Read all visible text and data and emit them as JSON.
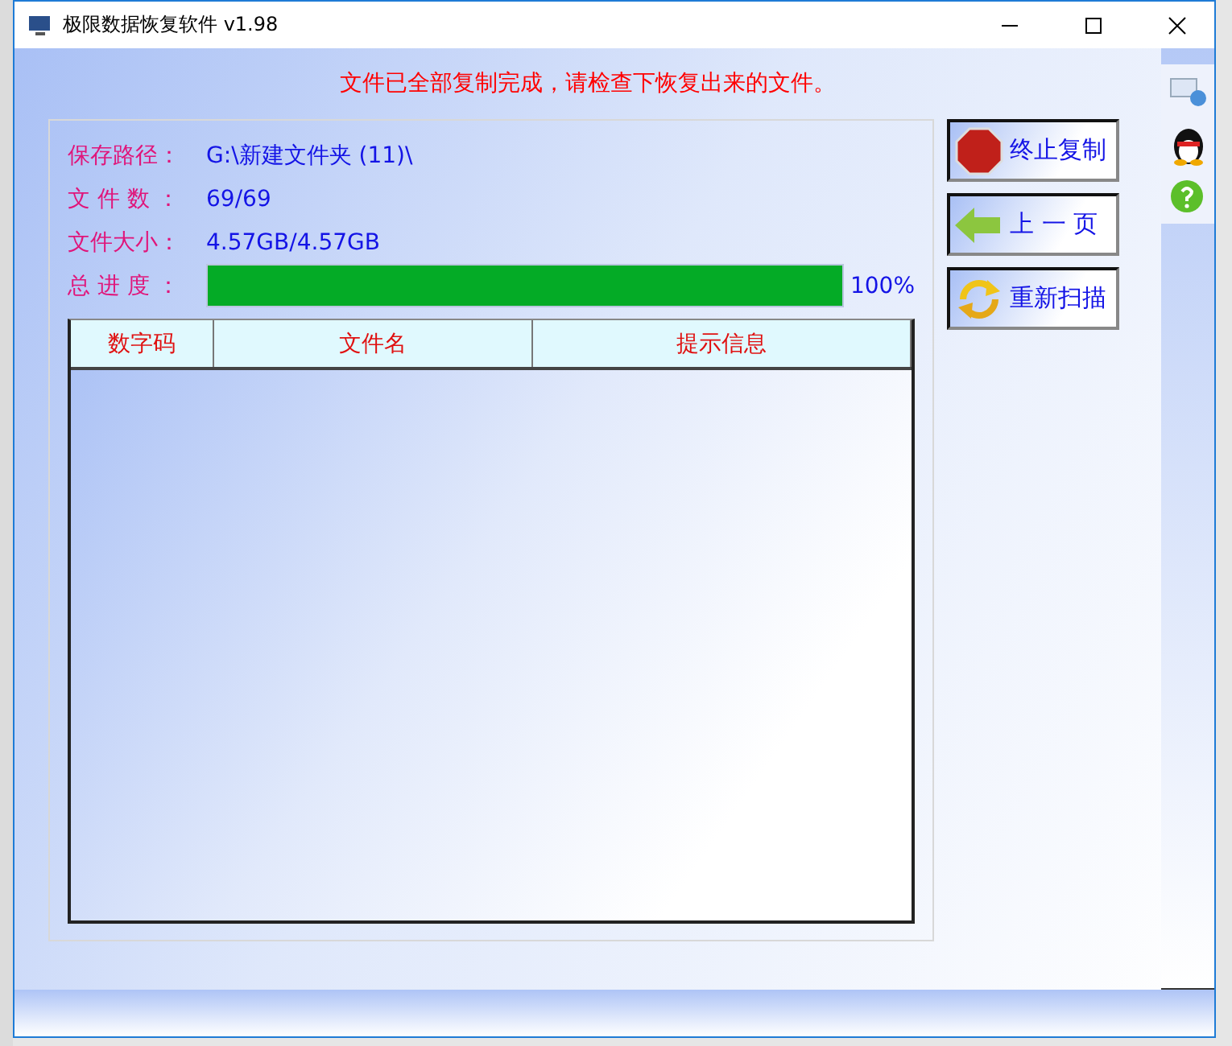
{
  "window": {
    "title": "极限数据恢复软件 v1.98"
  },
  "message": "文件已全部复制完成，请检查下恢复出来的文件。",
  "info": [
    {
      "label": "保存路径：",
      "value": "G:\\新建文件夹 (11)\\"
    },
    {
      "label": "文 件 数 ：",
      "value": "69/69"
    },
    {
      "label": "文件大小：",
      "value": "4.57GB/4.57GB"
    }
  ],
  "progress": {
    "label": "总 进 度 ：",
    "level": 1,
    "reading": "100%"
  },
  "table": {
    "columns": [
      "数字码",
      "文件名",
      "提示信息"
    ]
  },
  "buttons": [
    {
      "kind": "stop",
      "label": "终止复制"
    },
    {
      "kind": "back",
      "label": "上 一 页"
    },
    {
      "kind": "rescan",
      "label": "重新扫描"
    }
  ]
}
